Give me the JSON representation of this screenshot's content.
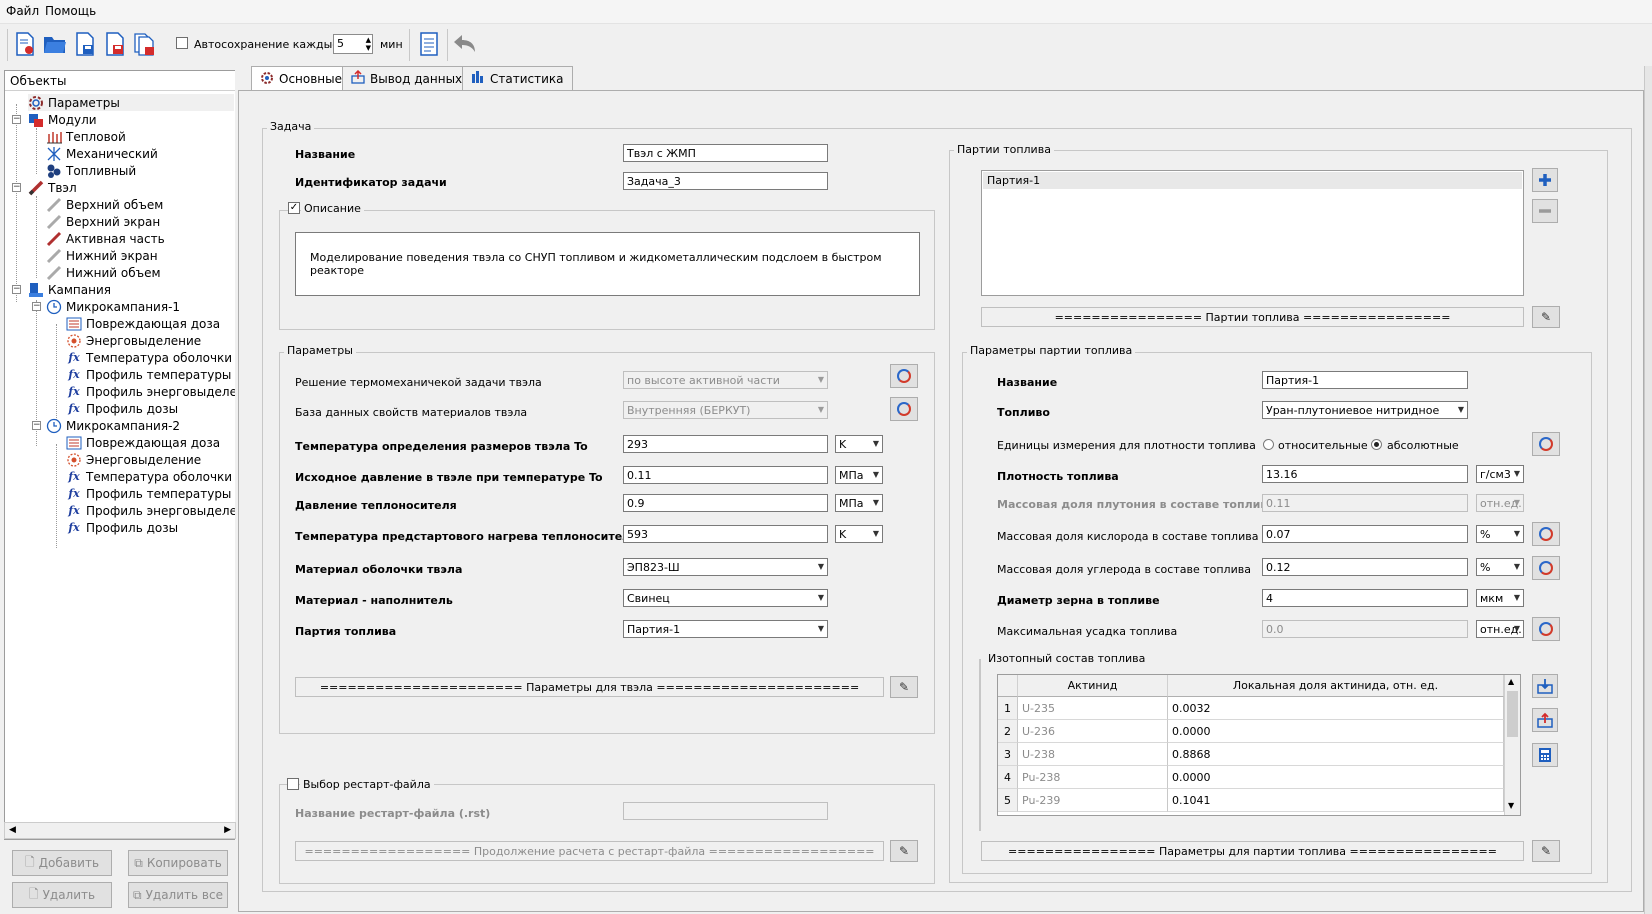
{
  "menu": {
    "file": "Файл",
    "help": "Помощь"
  },
  "toolbar": {
    "autosave_label": "Автосохранение каждые",
    "autosave_value": "5",
    "autosave_unit": "мин"
  },
  "tree": {
    "header": "Объекты",
    "items": [
      {
        "label": "Параметры"
      },
      {
        "label": "Модули"
      },
      {
        "label": "Тепловой"
      },
      {
        "label": "Механический"
      },
      {
        "label": "Топливный"
      },
      {
        "label": "Твэл"
      },
      {
        "label": "Верхний объем"
      },
      {
        "label": "Верхний экран"
      },
      {
        "label": "Активная часть"
      },
      {
        "label": "Нижний экран"
      },
      {
        "label": "Нижний объем"
      },
      {
        "label": "Кампания"
      },
      {
        "label": "Микрокампания-1"
      },
      {
        "label": "Повреждающая доза"
      },
      {
        "label": "Энерговыделение"
      },
      {
        "label": "Температура оболочки"
      },
      {
        "label": "Профиль температуры"
      },
      {
        "label": "Профиль энерговыделения"
      },
      {
        "label": "Профиль дозы"
      },
      {
        "label": "Микрокампания-2"
      },
      {
        "label": "Повреждающая доза"
      },
      {
        "label": "Энерговыделение"
      },
      {
        "label": "Температура оболочки"
      },
      {
        "label": "Профиль температуры"
      },
      {
        "label": "Профиль энерговыделения"
      },
      {
        "label": "Профиль дозы"
      }
    ],
    "buttons": {
      "add": "Добавить",
      "copy": "Копировать",
      "delete": "Удалить",
      "delete_all": "Удалить все"
    }
  },
  "tabs": [
    {
      "label": "Основные"
    },
    {
      "label": "Вывод данных"
    },
    {
      "label": "Статистика"
    }
  ],
  "task": {
    "group": "Задача",
    "name_label": "Название",
    "name_value": "Твэл с ЖМП",
    "id_label": "Идентификатор задачи",
    "id_value": "Задача_3",
    "desc_label": "Описание",
    "desc_value": "Моделирование поведения твэла со СНУП топливом и жидкометаллическим подслоем в быстром реакторе"
  },
  "params": {
    "group": "Параметры",
    "rows": [
      {
        "label": "Решение термомеханичекой задачи твэла",
        "value": "по высоте активной части"
      },
      {
        "label": "База данных свойств материалов твэла",
        "value": "Внутренняя (БЕРКУТ)"
      },
      {
        "label": "Температура определения размеров твэла To",
        "value": "293",
        "unit": "K"
      },
      {
        "label": "Исходное давление в твэле при температуре To",
        "value": "0.11",
        "unit": "МПа"
      },
      {
        "label": "Давление теплоносителя",
        "value": "0.9",
        "unit": "МПа"
      },
      {
        "label": "Температура предстартового нагрева теплоносителя",
        "value": "593",
        "unit": "K"
      },
      {
        "label": "Материал оболочки твэла",
        "value": "ЭП823-Ш"
      },
      {
        "label": "Материал - наполнитель",
        "value": "Свинец"
      },
      {
        "label": "Партия топлива",
        "value": "Партия-1"
      }
    ],
    "bar": "====================== Параметры для твэла ======================"
  },
  "restart": {
    "group": "Выбор рестарт-файла",
    "file_label": "Название рестарт-файла (.rst)",
    "file_value": "",
    "bar": "================== Продолжение расчета с рестарт-файла =================="
  },
  "batches": {
    "group": "Партии топлива",
    "items": [
      "Партия-1"
    ],
    "bar": "================ Партии топлива ================"
  },
  "batch_params": {
    "group": "Параметры партии топлива",
    "name_label": "Название",
    "name_value": "Партия-1",
    "fuel_label": "Топливо",
    "fuel_value": "Уран-плутониевое нитридное",
    "density_units_label": "Единицы измерения для плотности топлива",
    "radio_relative": "относительные",
    "radio_absolute": "абсолютные",
    "rows": [
      {
        "label": "Плотность топлива",
        "value": "13.16",
        "unit": "г/см3"
      },
      {
        "label": "Массовая доля плутония в составе топлива",
        "value": "0.11",
        "unit": "отн.ед."
      },
      {
        "label": "Массовая доля кислорода в составе топлива",
        "value": "0.07",
        "unit": "%"
      },
      {
        "label": "Массовая доля углерода в составе топлива",
        "value": "0.12",
        "unit": "%"
      },
      {
        "label": "Диаметр зерна в топливе",
        "value": "4",
        "unit": "мкм"
      },
      {
        "label": "Максимальная усадка топлива",
        "value": "0.0",
        "unit": "отн.ед."
      }
    ],
    "bar": "================ Параметры для партии топлива ================"
  },
  "isotopes": {
    "group": "Изотопный состав топлива",
    "columns": [
      "Актинид",
      "Локальная доля актинида, отн. ед."
    ],
    "rows": [
      {
        "n": "1",
        "name": "U-235",
        "value": "0.0032"
      },
      {
        "n": "2",
        "name": "U-236",
        "value": "0.0000"
      },
      {
        "n": "3",
        "name": "U-238",
        "value": "0.8868"
      },
      {
        "n": "4",
        "name": "Pu-238",
        "value": "0.0000"
      },
      {
        "n": "5",
        "name": "Pu-239",
        "value": "0.1041"
      }
    ]
  }
}
